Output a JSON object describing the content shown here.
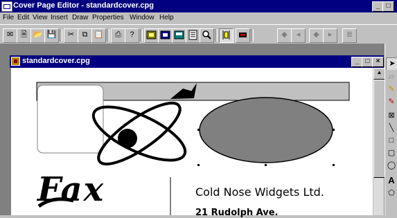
{
  "window": {
    "title": "Cover Page Editor - standardcover.cpg",
    "controls": [
      "_",
      "□",
      "×"
    ]
  },
  "menu": [
    "File",
    "Edit",
    "View",
    "Insert",
    "Draw",
    "Properties",
    "Window",
    "Help"
  ],
  "toolbar": {
    "buttons": [
      {
        "name": "envelope-icon",
        "glyph": "✉"
      },
      {
        "name": "new-page-icon",
        "glyph": "🗎"
      },
      {
        "name": "open-folder-icon",
        "glyph": "📂"
      },
      {
        "name": "save-icon",
        "glyph": "💾"
      },
      {
        "name": "cut-icon",
        "glyph": "✂"
      },
      {
        "name": "copy-icon",
        "glyph": "⧉"
      },
      {
        "name": "paste-icon",
        "glyph": "📋"
      },
      {
        "name": "print-icon",
        "glyph": "⎙"
      },
      {
        "name": "help-icon",
        "glyph": "?"
      }
    ]
  },
  "child": {
    "title": "standardcover.cpg",
    "controls": [
      "_",
      "□",
      "×"
    ]
  },
  "page": {
    "company_name": "Cold Nose Widgets Ltd.",
    "address_line": "21 Rudolph Ave.",
    "logo_text": "Fax"
  },
  "colors": {
    "title_bar": "#000080",
    "ellipse_fill": "#808080",
    "header_band": "#c0c0c0"
  }
}
